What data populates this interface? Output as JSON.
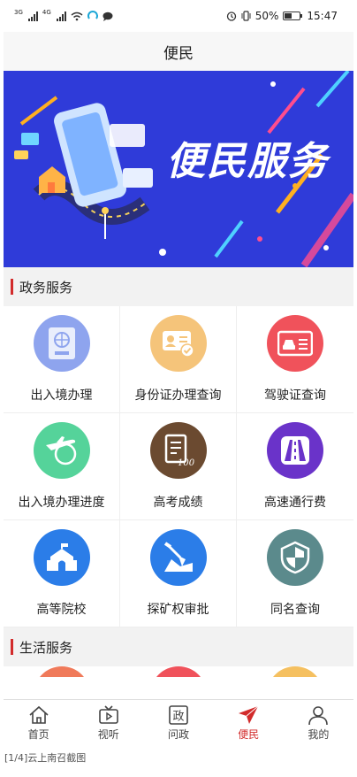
{
  "status_bar": {
    "signal1_tag": "3G",
    "signal2_tag": "4G",
    "battery_percent": "50%",
    "battery_level": 0.5,
    "time": "15:47"
  },
  "header": {
    "title": "便民"
  },
  "banner": {
    "title": "便民服务",
    "background": "#2f3bd9"
  },
  "sections": {
    "government": {
      "title": "政务服务",
      "items": [
        {
          "label": "出入境办理",
          "icon": "passport-icon",
          "color": "#8ea4ee"
        },
        {
          "label": "身份证办理查询",
          "icon": "id-card-icon",
          "color": "#f5c47a"
        },
        {
          "label": "驾驶证查询",
          "icon": "driver-license-icon",
          "color": "#f0525b"
        },
        {
          "label": "出入境办理进度",
          "icon": "airplane-globe-icon",
          "color": "#55d39a"
        },
        {
          "label": "高考成绩",
          "icon": "exam-score-icon",
          "color": "#6b4a30"
        },
        {
          "label": "高速通行费",
          "icon": "highway-icon",
          "color": "#6a33c9"
        },
        {
          "label": "高等院校",
          "icon": "college-icon",
          "color": "#2b7de8"
        },
        {
          "label": "探矿权审批",
          "icon": "mining-shovel-icon",
          "color": "#2b7de8"
        },
        {
          "label": "同名查询",
          "icon": "shield-icon",
          "color": "#5b8a8c"
        }
      ]
    },
    "life": {
      "title": "生活服务",
      "partial_icon_colors": [
        "#f07a5a",
        "#f0525b",
        "#f5c060"
      ]
    }
  },
  "tabbar": {
    "items": [
      {
        "label": "首页",
        "icon": "home-icon"
      },
      {
        "label": "视听",
        "icon": "tv-icon"
      },
      {
        "label": "问政",
        "icon": "politics-icon",
        "glyph": "政"
      },
      {
        "label": "便民",
        "icon": "paper-plane-icon",
        "active": true
      },
      {
        "label": "我的",
        "icon": "profile-icon"
      }
    ],
    "active_color": "#d22b2b"
  },
  "caption": "[1/4]云上南召截图"
}
